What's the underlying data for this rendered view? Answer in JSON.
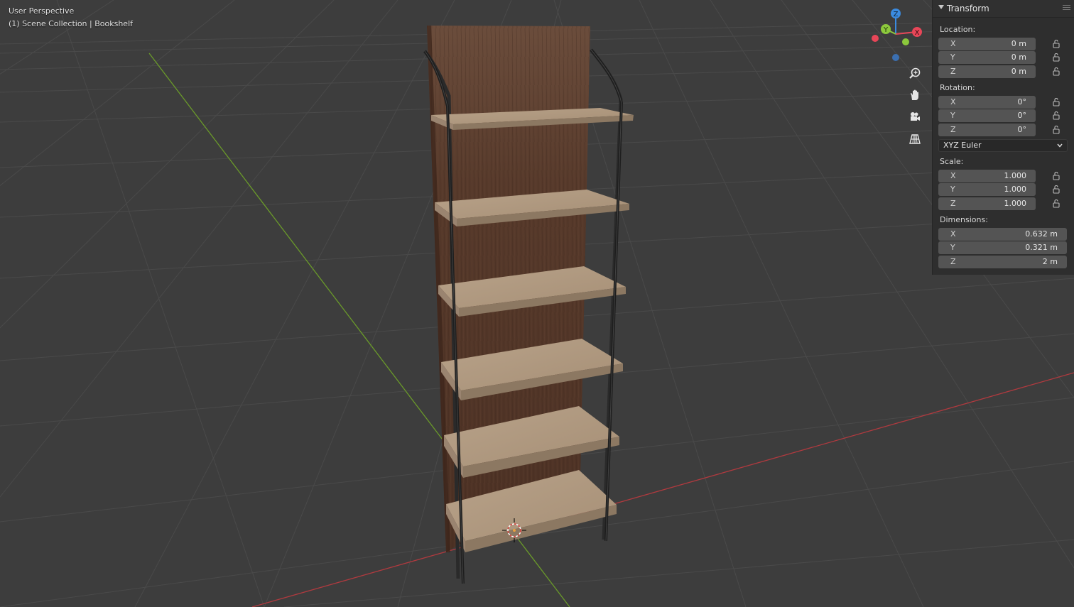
{
  "viewport": {
    "view_name": "User Perspective",
    "collection_path": "(1) Scene Collection | Bookshelf"
  },
  "gizmo": {
    "z_label": "Z",
    "y_label": "Y",
    "x_label": "X"
  },
  "nav_icons": [
    "zoom-icon",
    "hand-pan-icon",
    "camera-icon",
    "grid-view-icon"
  ],
  "transform": {
    "title": "Transform",
    "location": {
      "label": "Location:",
      "x": {
        "axis": "X",
        "value": "0 m"
      },
      "y": {
        "axis": "Y",
        "value": "0 m"
      },
      "z": {
        "axis": "Z",
        "value": "0 m"
      }
    },
    "rotation": {
      "label": "Rotation:",
      "x": {
        "axis": "X",
        "value": "0°"
      },
      "y": {
        "axis": "Y",
        "value": "0°"
      },
      "z": {
        "axis": "Z",
        "value": "0°"
      },
      "mode": "XYZ Euler"
    },
    "scale": {
      "label": "Scale:",
      "x": {
        "axis": "X",
        "value": "1.000"
      },
      "y": {
        "axis": "Y",
        "value": "1.000"
      },
      "z": {
        "axis": "Z",
        "value": "1.000"
      }
    },
    "dimensions": {
      "label": "Dimensions:",
      "x": {
        "axis": "X",
        "value": "0.632 m"
      },
      "y": {
        "axis": "Y",
        "value": "0.321 m"
      },
      "z": {
        "axis": "Z",
        "value": "2 m"
      }
    }
  },
  "colors": {
    "background": "#3d3d3d",
    "grid_line": "#4a4a4a",
    "x_axis": "#b03a3f",
    "y_axis": "#6a9a2a",
    "gizmo_x": "#e84658",
    "gizmo_y": "#8cc83c",
    "gizmo_z": "#3b8be0",
    "panel": "#2e2e2e",
    "field": "#545454"
  }
}
